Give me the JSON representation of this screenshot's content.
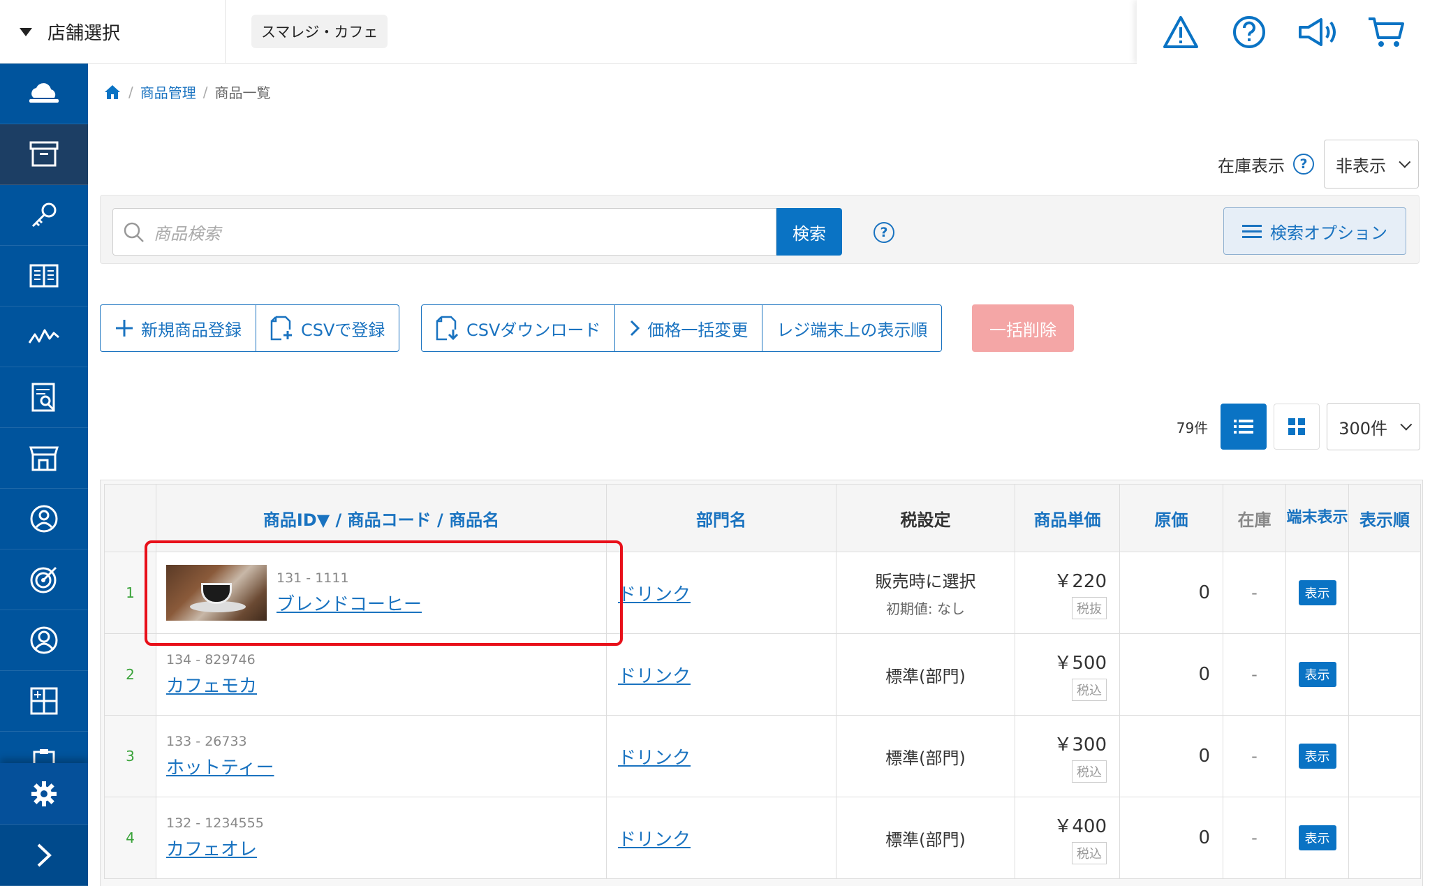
{
  "topbar": {
    "store_select_label": "店舗選択",
    "current_store": "スマレジ・カフェ",
    "icons": [
      "warning-icon",
      "help-icon",
      "announcement-icon",
      "cart-icon"
    ]
  },
  "sidebar": {
    "items": [
      "cloud-icon",
      "box-icon",
      "key-icon",
      "book-icon",
      "chart-icon",
      "report-icon",
      "store-icon",
      "customer-icon",
      "target-icon",
      "user-icon",
      "grid-icon",
      "clipboard-icon"
    ],
    "active_index": 1,
    "bottom": [
      "gear-icon",
      "chevron-right-icon"
    ]
  },
  "breadcrumb": {
    "home_icon": "home-icon",
    "level1": "商品管理",
    "current": "商品一覧",
    "sep": "/"
  },
  "stock_display": {
    "label": "在庫表示",
    "value": "非表示"
  },
  "search": {
    "placeholder": "商品検索",
    "button": "検索",
    "options_button": "検索オプション"
  },
  "actions": {
    "new_product": "新規商品登録",
    "csv_register": "CSVで登録",
    "csv_download": "CSVダウンロード",
    "bulk_price": "価格一括変更",
    "display_order": "レジ端末上の表示順",
    "bulk_delete": "一括削除"
  },
  "list": {
    "count": "79件",
    "per_page": "300件"
  },
  "table": {
    "headers": {
      "id_code_name": "商品ID▼ / 商品コード / 商品名",
      "dept": "部門名",
      "tax": "税設定",
      "unit_price": "商品単価",
      "cost": "原価",
      "stock": "在庫",
      "terminal_display": "端末表示",
      "display_order": "表示順"
    },
    "rows": [
      {
        "num": "1",
        "id": "131",
        "code": "1111",
        "name": "ブレンドコーヒー",
        "dept": "ドリンク",
        "tax": "販売時に選択",
        "tax_sub": "初期値: なし",
        "price": "￥220",
        "tax_tag": "税抜",
        "cost": "0",
        "stock": "-",
        "display": "表示"
      },
      {
        "num": "2",
        "id": "134",
        "code": "829746",
        "name": "カフェモカ",
        "dept": "ドリンク",
        "tax": "標準(部門)",
        "tax_sub": "",
        "price": "￥500",
        "tax_tag": "税込",
        "cost": "0",
        "stock": "-",
        "display": "表示"
      },
      {
        "num": "3",
        "id": "133",
        "code": "26733",
        "name": "ホットティー",
        "dept": "ドリンク",
        "tax": "標準(部門)",
        "tax_sub": "",
        "price": "￥300",
        "tax_tag": "税込",
        "cost": "0",
        "stock": "-",
        "display": "表示"
      },
      {
        "num": "4",
        "id": "132",
        "code": "1234555",
        "name": "カフェオレ",
        "dept": "ドリンク",
        "tax": "標準(部門)",
        "tax_sub": "",
        "price": "￥400",
        "tax_tag": "税込",
        "cost": "0",
        "stock": "-",
        "display": "表示"
      }
    ]
  },
  "colors": {
    "sidebar": "#00549d",
    "accent": "#0a73c4",
    "highlight": "#e8101a",
    "delete_disabled": "#f4a6a6"
  }
}
